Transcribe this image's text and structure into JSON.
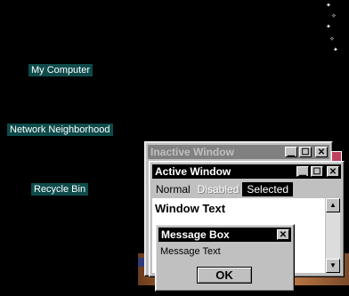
{
  "desktop": {
    "icons": [
      {
        "label": "My Computer"
      },
      {
        "label": "Network Neighborhood"
      },
      {
        "label": "Recycle Bin"
      }
    ]
  },
  "inactive_window": {
    "title": "Inactive Window",
    "buttons": {
      "minimize": "▁",
      "maximize": "☐",
      "close": "✕"
    }
  },
  "active_window": {
    "title": "Active Window",
    "buttons": {
      "minimize": "▁",
      "maximize": "☐",
      "close": "✕"
    },
    "menu": {
      "normal": "Normal",
      "disabled": "Disabled",
      "selected": "Selected"
    },
    "body_text": "Window Text"
  },
  "message_box": {
    "title": "Message Box",
    "close": "✕",
    "text": "Message Text",
    "ok_label": "OK"
  },
  "colors": {
    "desktop": "#000000",
    "icon_label_bg": "#0e4a4a",
    "active_title": "#000000",
    "inactive_title": "#808080",
    "selection": "#000000"
  }
}
